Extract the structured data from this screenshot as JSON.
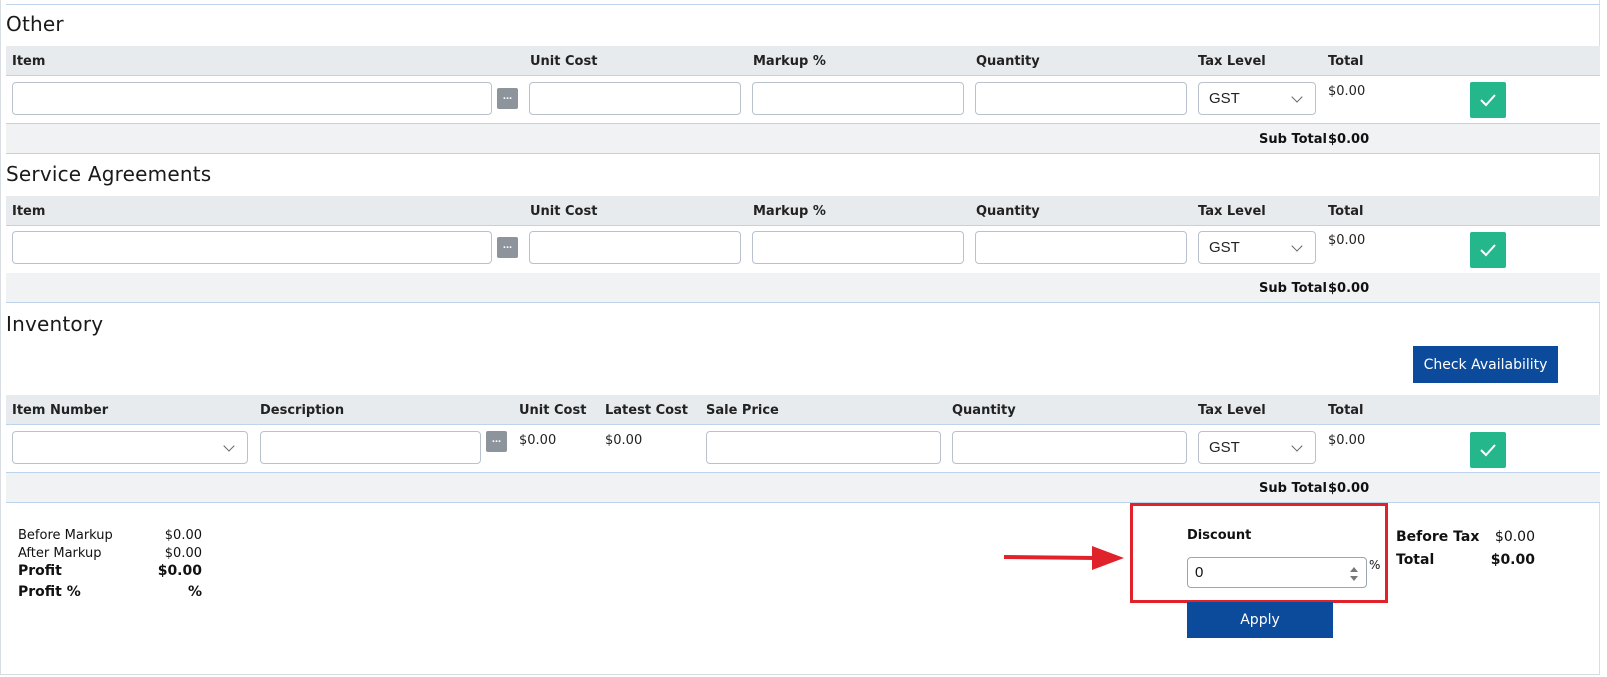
{
  "sections": {
    "other": {
      "title": "Other",
      "headers": {
        "item": "Item",
        "unit_cost": "Unit Cost",
        "markup": "Markup %",
        "quantity": "Quantity",
        "tax_level": "Tax Level",
        "total": "Total"
      },
      "row": {
        "item": "",
        "unit_cost": "",
        "markup": "",
        "quantity": "",
        "tax_level": "GST",
        "total": "$0.00",
        "dots": "..."
      },
      "sub_total_label": "Sub Total",
      "sub_total_value": "$0.00"
    },
    "service": {
      "title": "Service Agreements",
      "headers": {
        "item": "Item",
        "unit_cost": "Unit Cost",
        "markup": "Markup %",
        "quantity": "Quantity",
        "tax_level": "Tax Level",
        "total": "Total"
      },
      "row": {
        "item": "",
        "unit_cost": "",
        "markup": "",
        "quantity": "",
        "tax_level": "GST",
        "total": "$0.00",
        "dots": "..."
      },
      "sub_total_label": "Sub Total",
      "sub_total_value": "$0.00"
    },
    "inventory": {
      "title": "Inventory",
      "check_availability": "Check Availability",
      "headers": {
        "item_number": "Item Number",
        "description": "Description",
        "unit_cost": "Unit Cost",
        "latest_cost": "Latest Cost",
        "sale_price": "Sale Price",
        "quantity": "Quantity",
        "tax_level": "Tax Level",
        "total": "Total"
      },
      "row": {
        "item_number": "",
        "description": "",
        "unit_cost": "$0.00",
        "latest_cost": "$0.00",
        "sale_price": "",
        "quantity": "",
        "tax_level": "GST",
        "total": "$0.00",
        "dots": "..."
      },
      "sub_total_label": "Sub Total",
      "sub_total_value": "$0.00"
    }
  },
  "summary": {
    "before_markup_label": "Before Markup",
    "before_markup_value": "$0.00",
    "after_markup_label": "After Markup",
    "after_markup_value": "$0.00",
    "profit_label": "Profit",
    "profit_value": "$0.00",
    "profit_pct_label": "Profit %",
    "profit_pct_value": "%"
  },
  "discount": {
    "label": "Discount",
    "value": "0",
    "unit": "%",
    "apply": "Apply"
  },
  "totals": {
    "before_tax_label": "Before Tax",
    "before_tax_value": "$0.00",
    "total_label": "Total",
    "total_value": "$0.00"
  },
  "colors": {
    "accent": "#0c4a9c",
    "success": "#24b78b",
    "highlight": "#e0232a"
  }
}
